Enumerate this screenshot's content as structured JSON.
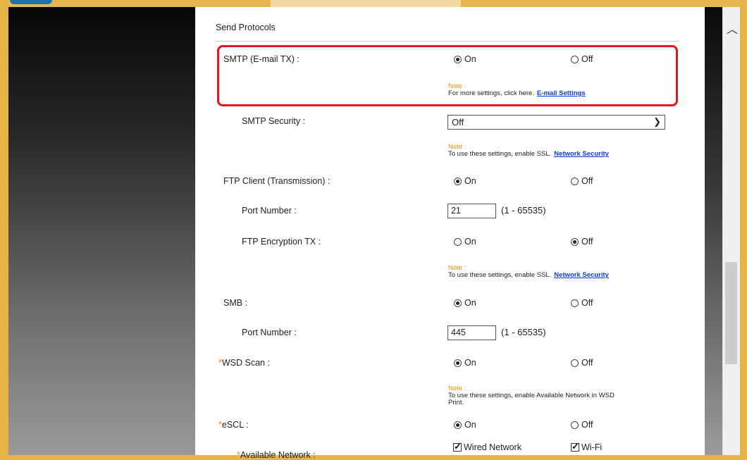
{
  "section": {
    "title": "Send Protocols"
  },
  "radio_labels": {
    "on": "On",
    "off": "Off"
  },
  "note_label": "Note :",
  "required_mark": "*",
  "rows": {
    "smtp": {
      "label": "SMTP (E-mail TX) :",
      "selected": "On"
    },
    "smtp_note": {
      "text": "For more settings, click here.",
      "link": "E-mail Settings"
    },
    "smtp_security": {
      "label": "SMTP Security :",
      "value": "Off"
    },
    "smtp_security_note": {
      "text": "To use these settings, enable SSL.",
      "link": "Network Security"
    },
    "ftp_client": {
      "label": "FTP Client (Transmission) :",
      "selected": "On"
    },
    "ftp_port": {
      "label": "Port Number :",
      "value": "21",
      "range": "(1 - 65535)"
    },
    "ftp_encryption": {
      "label": "FTP Encryption TX :",
      "selected": "Off"
    },
    "ftp_note": {
      "text": "To use these settings, enable SSL.",
      "link": "Network Security"
    },
    "smb": {
      "label": "SMB :",
      "selected": "On"
    },
    "smb_port": {
      "label": "Port Number :",
      "value": "445",
      "range": "(1 - 65535)"
    },
    "wsd_scan": {
      "label": "WSD Scan :",
      "selected": "On"
    },
    "wsd_note": {
      "line1": "To use these settings, enable Available Network in WSD",
      "line2": "Print."
    },
    "escl": {
      "label": "eSCL :",
      "selected": "On"
    },
    "available_network": {
      "label": "Available Network :",
      "options": [
        "Wired Network",
        "Wi-Fi"
      ]
    }
  },
  "colors": {
    "highlight": "#e8141b",
    "note": "#f08a00",
    "link": "#0a3cd6"
  }
}
